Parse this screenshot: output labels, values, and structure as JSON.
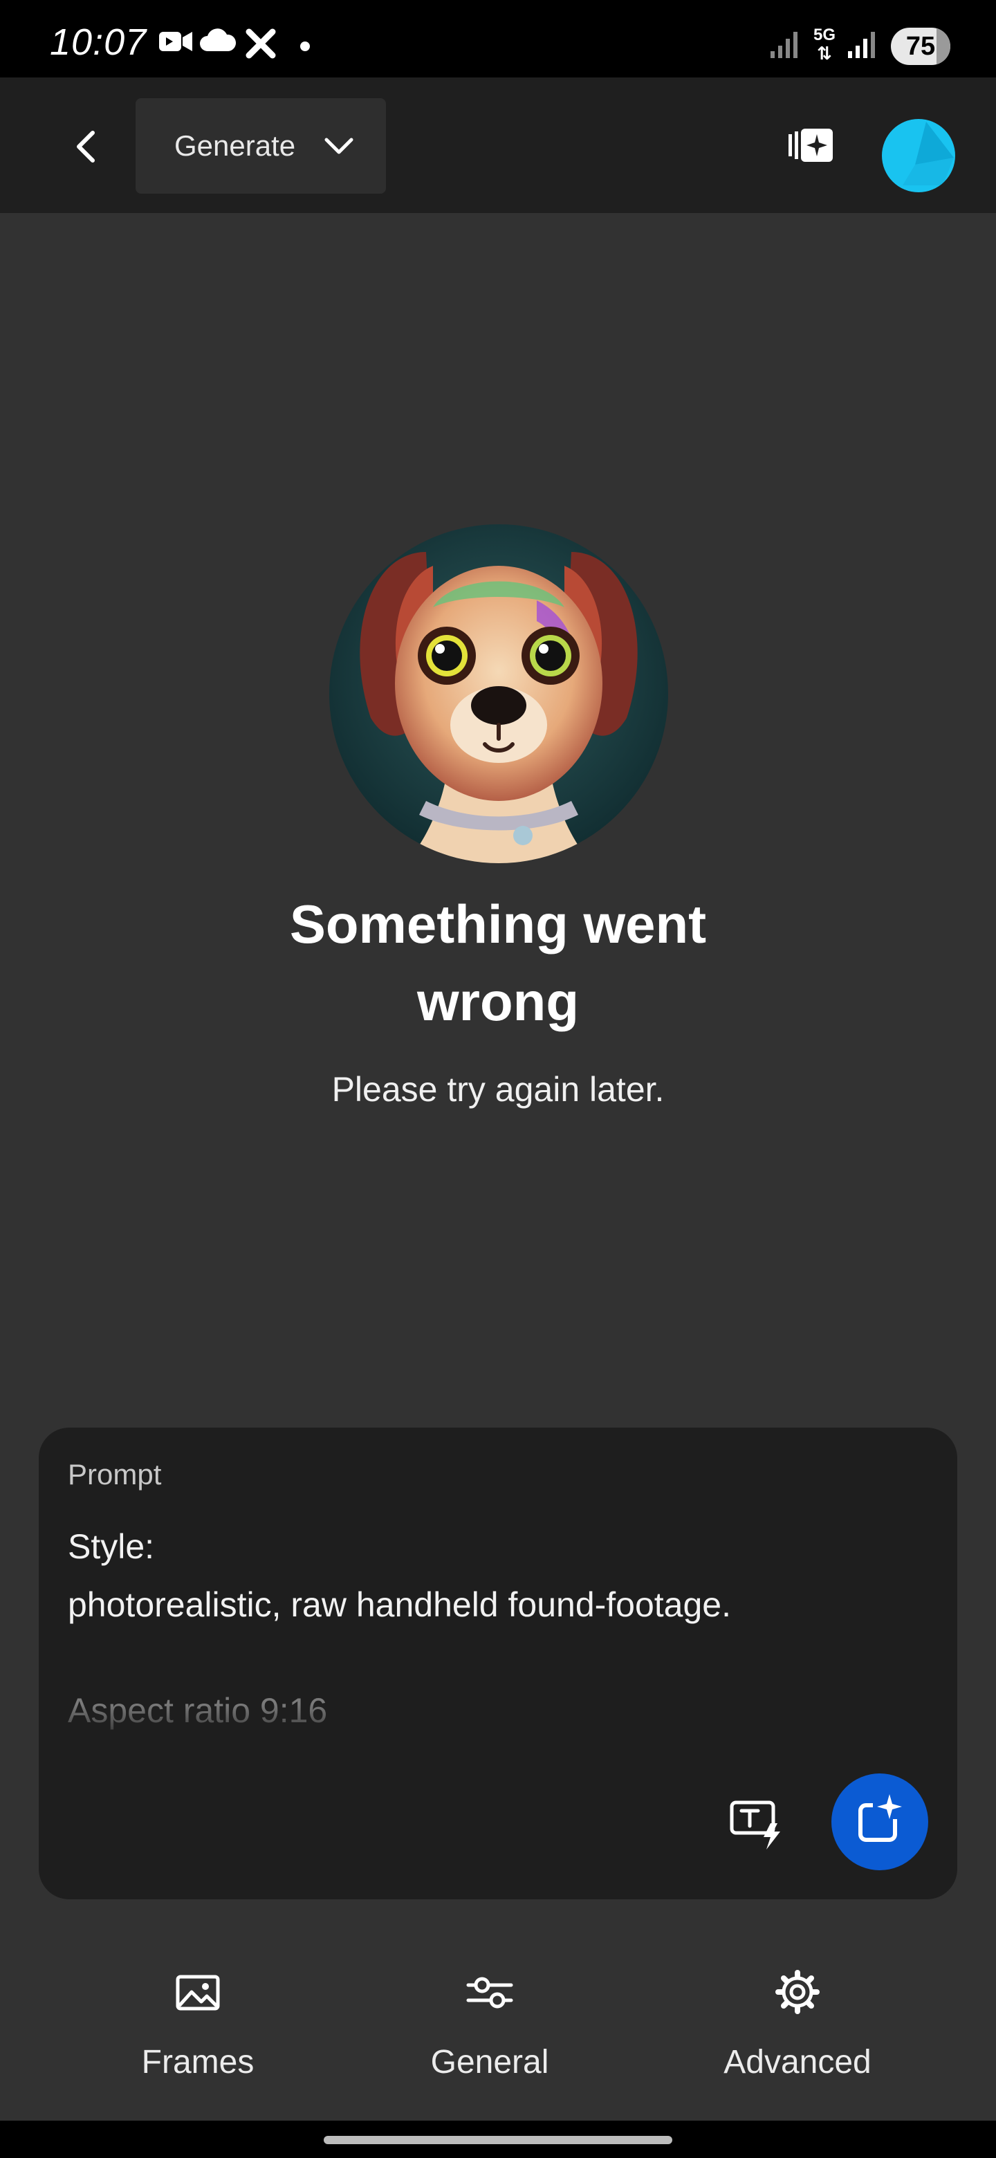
{
  "status_bar": {
    "time": "10:07",
    "network": "5G",
    "battery": "75"
  },
  "top_bar": {
    "mode_label": "Generate"
  },
  "error": {
    "title_line1": "Something went",
    "title_line2": "wrong",
    "subtitle": "Please try again later."
  },
  "prompt": {
    "label": "Prompt",
    "line1": "Style:",
    "line2": "photorealistic, raw handheld found-footage.",
    "line3": "Aspect ratio 9:16"
  },
  "tabs": [
    {
      "label": "Frames",
      "icon": "image-icon"
    },
    {
      "label": "General",
      "icon": "sliders-icon"
    },
    {
      "label": "Advanced",
      "icon": "gear-icon"
    }
  ],
  "colors": {
    "background": "#323232",
    "top_bar": "#1f1f1f",
    "card": "#1e1e1e",
    "accent": "#0b5bd3",
    "avatar": "#19c3f0"
  }
}
